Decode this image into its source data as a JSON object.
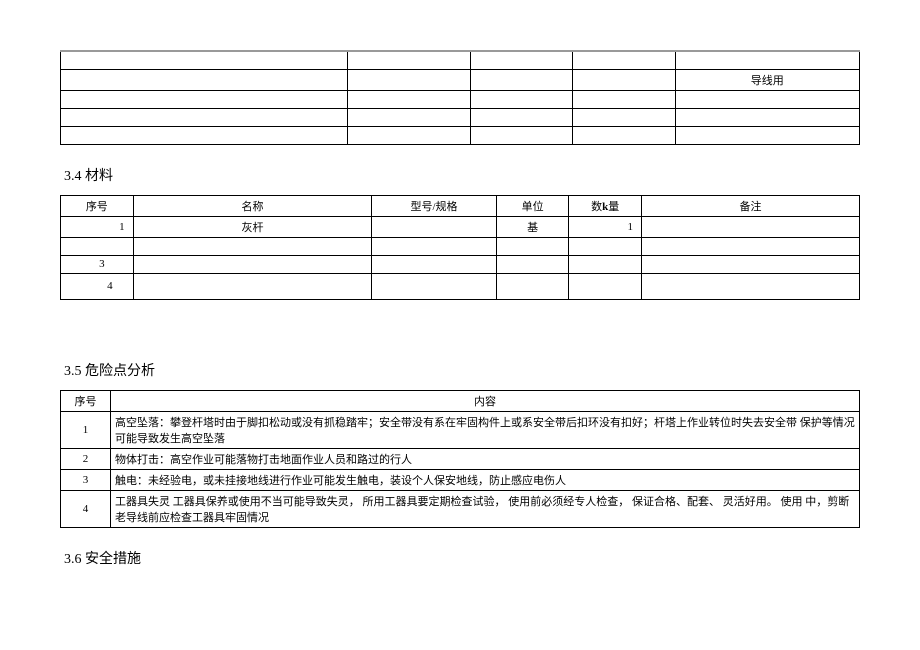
{
  "top_table": {
    "note_cell": "导线用",
    "rows": 5
  },
  "section34": {
    "heading": "3.4 材料",
    "headers": {
      "seq": "序号",
      "name": "名称",
      "spec": "型号/规格",
      "unit": "单位",
      "qty": "数量",
      "remark": "备注"
    },
    "rows": [
      {
        "seq": "1",
        "name": "灰杆",
        "spec": "",
        "unit": "基",
        "qty": "1",
        "remark": ""
      },
      {
        "seq": "",
        "name": "",
        "spec": "",
        "unit": "",
        "qty": "",
        "remark": ""
      },
      {
        "seq": "3",
        "name": "",
        "spec": "",
        "unit": "",
        "qty": "",
        "remark": ""
      },
      {
        "seq": "4",
        "name": "",
        "spec": "",
        "unit": "",
        "qty": "",
        "remark": ""
      }
    ]
  },
  "section35": {
    "heading": "3.5 危险点分析",
    "headers": {
      "seq": "序号",
      "content": "内容"
    },
    "rows": [
      {
        "seq": "1",
        "content": "高空坠落：攀登杆塔时由于脚扣松动或没有抓稳踏牢；安全带没有系在牢固构件上或系安全带后扣环没有扣好；杆塔上作业转位时失去安全带 保护等情况可能导致发生高空坠落"
      },
      {
        "seq": "2",
        "content": "物体打击：高空作业可能落物打击地面作业人员和路过的行人"
      },
      {
        "seq": "3",
        "content": "触电：未经验电，或未挂接地线进行作业可能发生触电，装设个人保安地线，防止感应电伤人"
      },
      {
        "seq": "4",
        "content": "工器具失灵 工器具保养或使用不当可能导致失灵， 所用工器具要定期检查试验， 使用前必须经专人检查， 保证合格、配套、 灵活好用。 使用 中，剪断老导线前应检查工器具牢固情况"
      }
    ]
  },
  "section36": {
    "heading": "3.6 安全措施"
  }
}
